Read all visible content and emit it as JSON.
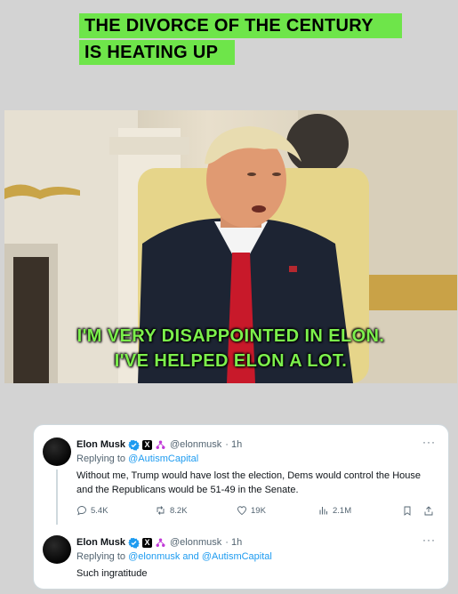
{
  "headline": {
    "line1": "THE DIVORCE OF THE CENTURY",
    "line2": "IS HEATING UP"
  },
  "video": {
    "caption_line1": "I'M VERY DISAPPOINTED IN ELON.",
    "caption_line2": "I'VE HELPED ELON A LOT."
  },
  "tweets": [
    {
      "name": "Elon Musk",
      "handle": "@elonmusk",
      "time": "· 1h",
      "more": "···",
      "replying_prefix": "Replying to",
      "replying_to": "@AutismCapital",
      "text": "Without me, Trump would have lost the election, Dems would control the House and the Republicans would be 51-49 in the Senate.",
      "stats": {
        "replies": "5.4K",
        "reposts": "8.2K",
        "likes": "19K",
        "views": "2.1M"
      }
    },
    {
      "name": "Elon Musk",
      "handle": "@elonmusk",
      "time": "· 1h",
      "more": "···",
      "replying_prefix": "Replying to",
      "replying_to": "@elonmusk and @AutismCapital",
      "text": "Such ingratitude"
    }
  ],
  "colors": {
    "headline_bg": "#6ee54a",
    "caption": "#7cf04c",
    "link": "#1d9bf0",
    "verified": "#1d9bf0"
  },
  "icons": [
    "verified-badge-icon",
    "x-logo-icon",
    "affiliate-badge-icon",
    "more-icon",
    "reply-icon",
    "repost-icon",
    "like-icon",
    "views-icon",
    "bookmark-icon",
    "share-icon"
  ]
}
